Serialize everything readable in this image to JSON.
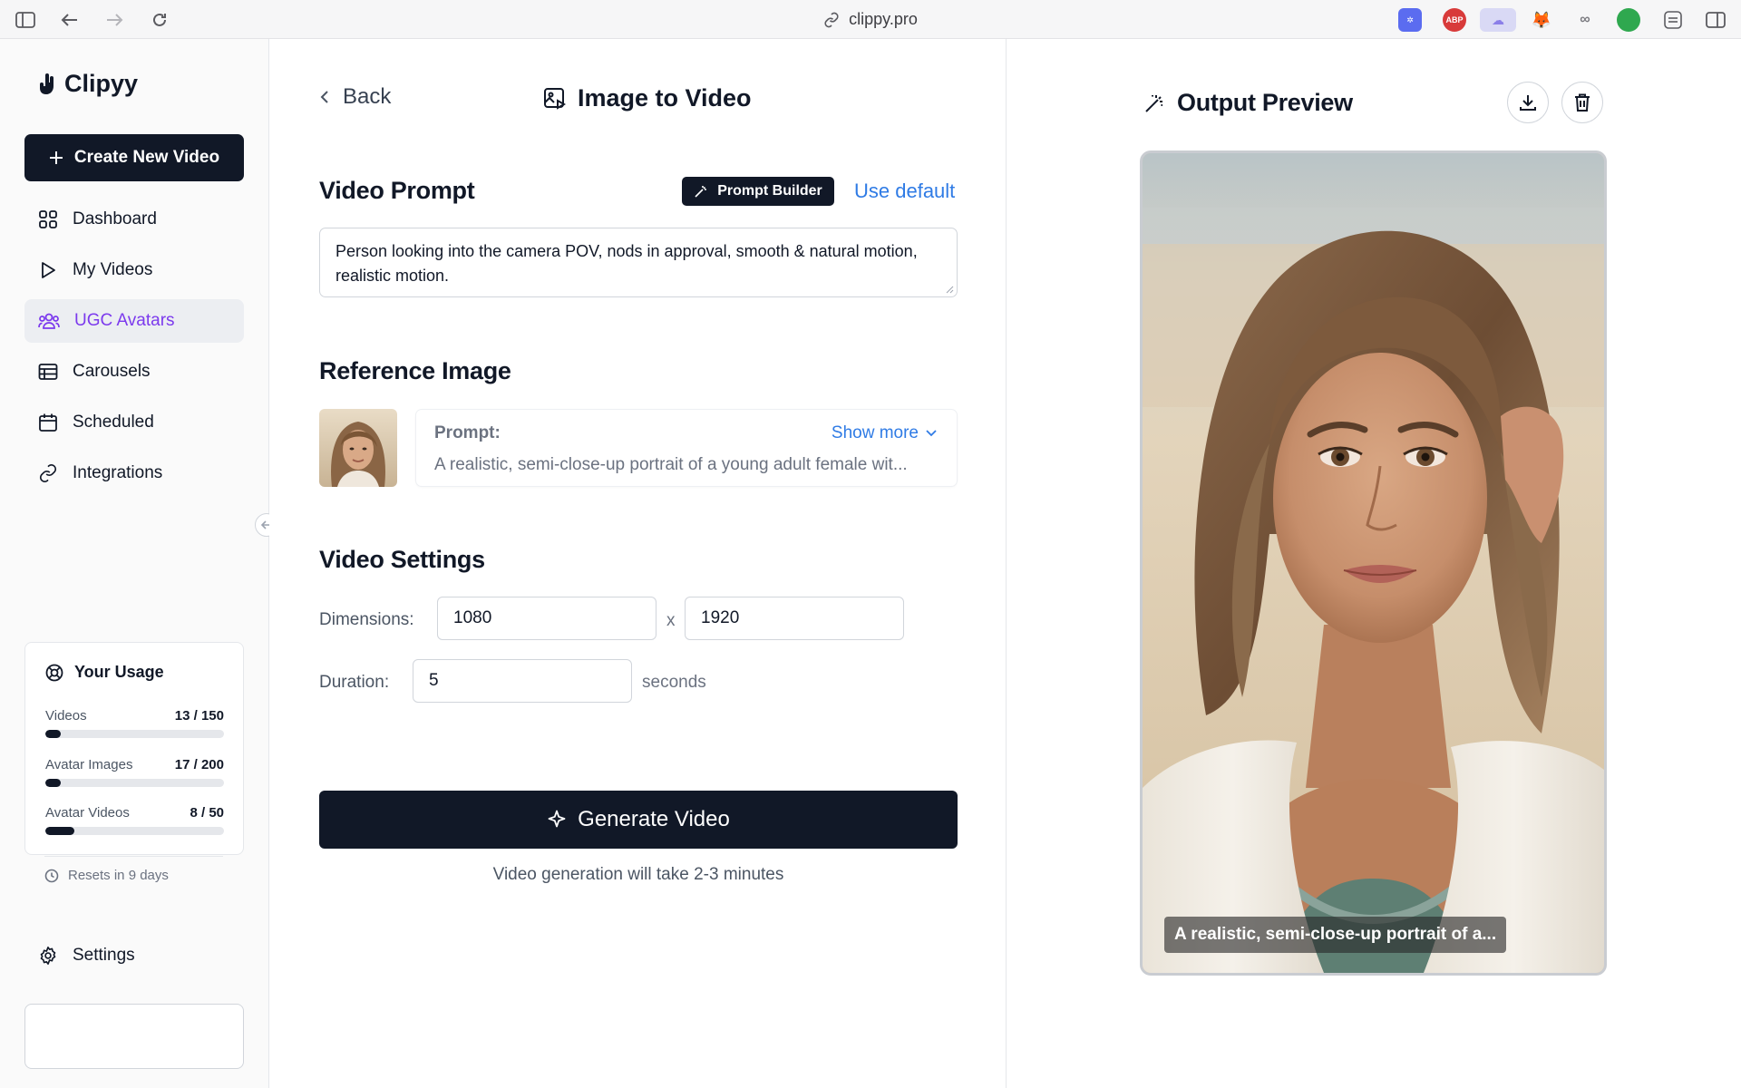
{
  "browser": {
    "url": "clippy.pro"
  },
  "sidebar": {
    "logo": "Clipyy",
    "create_button": "Create New Video",
    "items": [
      {
        "label": "Dashboard",
        "icon": "grid-icon"
      },
      {
        "label": "My Videos",
        "icon": "play-icon"
      },
      {
        "label": "UGC Avatars",
        "icon": "users-icon",
        "active": true
      },
      {
        "label": "Carousels",
        "icon": "table-icon"
      },
      {
        "label": "Scheduled",
        "icon": "calendar-icon"
      },
      {
        "label": "Integrations",
        "icon": "link-icon"
      }
    ],
    "usage": {
      "title": "Your Usage",
      "rows": [
        {
          "label": "Videos",
          "value": "13 / 150",
          "used": 13,
          "total": 150
        },
        {
          "label": "Avatar Images",
          "value": "17 / 200",
          "used": 17,
          "total": 200
        },
        {
          "label": "Avatar Videos",
          "value": "8 / 50",
          "used": 8,
          "total": 50
        }
      ],
      "reset": "Resets in 9 days"
    },
    "settings": "Settings"
  },
  "main": {
    "back": "Back",
    "title": "Image to Video",
    "video_prompt": {
      "title": "Video Prompt",
      "prompt_builder": "Prompt Builder",
      "use_default": "Use default",
      "value": "Person looking into the camera POV, nods in approval, smooth & natural motion, realistic motion."
    },
    "reference": {
      "title": "Reference Image",
      "prompt_label": "Prompt:",
      "show_more": "Show more",
      "prompt_text": "A realistic, semi-close-up portrait of a young adult female wit..."
    },
    "settings": {
      "title": "Video Settings",
      "dimensions_label": "Dimensions:",
      "width": "1080",
      "x": "x",
      "height": "1920",
      "duration_label": "Duration:",
      "duration": "5",
      "seconds": "seconds"
    },
    "generate": "Generate Video",
    "note": "Video generation will take 2-3 minutes"
  },
  "preview": {
    "title": "Output Preview",
    "caption": "A realistic, semi-close-up portrait of a..."
  },
  "colors": {
    "accent": "#7c3aed",
    "link": "#2f7be5",
    "primary": "#111827"
  }
}
